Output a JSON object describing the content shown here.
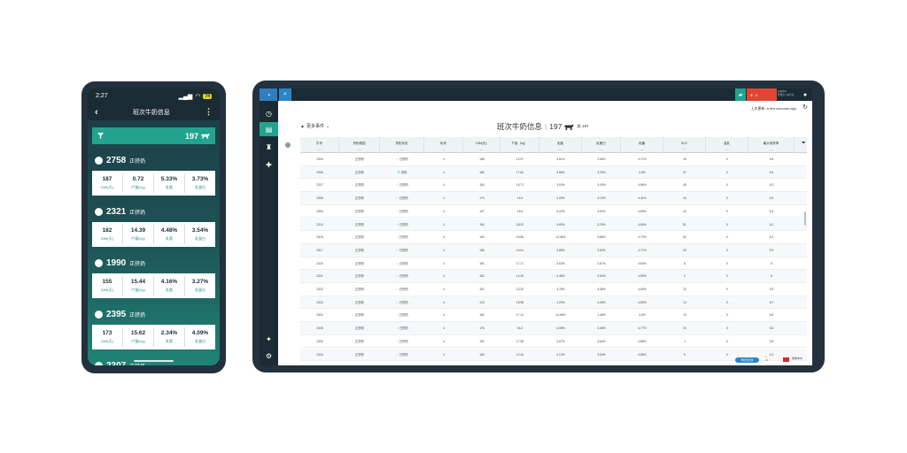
{
  "phone": {
    "time": "2:27",
    "battery": "74",
    "title": "班次牛奶信息",
    "count": "197",
    "items": [
      {
        "id": "2758",
        "type": "正挤奶",
        "dim": "187",
        "yield": "0.72",
        "fat": "5.33%",
        "protein": "3.73%",
        "dim_label": "DIM(天)",
        "yield_label": "产量(Kg)",
        "fat_label": "乳脂",
        "protein_label": "乳蛋白"
      },
      {
        "id": "2321",
        "type": "正挤奶",
        "dim": "182",
        "yield": "14.39",
        "fat": "4.48%",
        "protein": "3.54%",
        "dim_label": "DIM(天)",
        "yield_label": "产量(Kg)",
        "fat_label": "乳脂",
        "protein_label": "乳蛋白"
      },
      {
        "id": "1990",
        "type": "正挤奶",
        "dim": "155",
        "yield": "15.44",
        "fat": "4.16%",
        "protein": "3.27%",
        "dim_label": "DIM(天)",
        "yield_label": "产量(Kg)",
        "fat_label": "乳脂",
        "protein_label": "乳蛋白"
      },
      {
        "id": "2395",
        "type": "正挤奶",
        "dim": "173",
        "yield": "15.62",
        "fat": "2.34%",
        "protein": "4.09%",
        "dim_label": "DIM(天)",
        "yield_label": "产量(Kg)",
        "fat_label": "乳脂",
        "protein_label": "乳蛋白"
      },
      {
        "id": "2307",
        "type": "正挤奶"
      }
    ]
  },
  "tablet": {
    "alert_text": "4",
    "user_lines": [
      "gdfgfdsd",
      "管理员 1 用户名"
    ],
    "last_update": "上次更新: a few seconds ago",
    "more_events": "更多事件",
    "page_title": "班次牛奶信息",
    "count": "197",
    "count_total": "总 197",
    "columns": [
      "牛号",
      "挤奶原因",
      "挤奶状态",
      "乳号",
      "DIM(天)",
      "产量（kg）",
      "乳脂",
      "乳蛋白",
      "乳糖",
      "SCC",
      "温乳",
      "最大电导率"
    ],
    "filter_marks": [
      "—",
      "—",
      "—",
      "—",
      "—",
      "—",
      "—",
      "—",
      "—",
      "—",
      "—",
      "—"
    ],
    "rows": [
      [
        "2309",
        "正挤奶",
        "已挤奶",
        "4",
        "188",
        "12.97",
        "4.61%",
        "3.56%",
        "4.71%",
        "15",
        "0",
        "5.6"
      ],
      [
        "2306",
        "正挤奶",
        "挤奶",
        "4",
        "186",
        "17.64",
        "3.66%",
        "3.29%",
        "4.8%",
        "37",
        "0",
        "5.5"
      ],
      [
        "2307",
        "正挤奶",
        "已挤奶",
        "4",
        "184",
        "16.71",
        "3.64%",
        "3.43%",
        "4.86%",
        "48",
        "0",
        "6.3"
      ],
      [
        "2308",
        "正挤奶",
        "已挤奶",
        "4",
        "173",
        "13.3",
        "4.09%",
        "3.19%",
        "4.41%",
        "44",
        "0",
        "5.5"
      ],
      [
        "2300",
        "正挤奶",
        "已挤奶",
        "4",
        "147",
        "15.6",
        "5.22%",
        "3.52%",
        "4.89%",
        "44",
        "0",
        "5.4"
      ],
      [
        "2310",
        "正挤奶",
        "已挤奶",
        "4",
        "164",
        "18.02",
        "4.69%",
        "3.29%",
        "4.84%",
        "81",
        "0",
        "6.1"
      ],
      [
        "2315",
        "正挤奶",
        "已挤奶",
        "4",
        "160",
        "13.85",
        "13.36%",
        "0.86%",
        "4.72%",
        "50",
        "0",
        "6.2"
      ],
      [
        "2317",
        "正挤奶",
        "已挤奶",
        "4",
        "156",
        "13.01",
        "3.85%",
        "3.52%",
        "4.71%",
        "20",
        "0",
        "5.9"
      ],
      [
        "2320",
        "正挤奶",
        "已挤奶",
        "4",
        "191",
        "17.17",
        "4.63%",
        "3.67%",
        "4.84%",
        "8",
        "0",
        "6"
      ],
      [
        "2321",
        "正挤奶",
        "已挤奶",
        "4",
        "182",
        "14.29",
        "4.48%",
        "3.54%",
        "4.89%",
        "2",
        "0",
        "6"
      ],
      [
        "2322",
        "正挤奶",
        "已挤奶",
        "4",
        "152",
        "13.02",
        "4.78%",
        "3.48%",
        "4.65%",
        "12",
        "0",
        "5.5"
      ],
      [
        "2323",
        "正挤奶",
        "已挤奶",
        "4",
        "143",
        "15.96",
        "1.03%",
        "4.49%",
        "4.89%",
        "12",
        "0",
        "5.7"
      ],
      [
        "2324",
        "正挤奶",
        "已挤奶",
        "4",
        "180",
        "17.14",
        "13.66%",
        "1.46%",
        "4.6%",
        "10",
        "0",
        "6.6"
      ],
      [
        "2326",
        "正挤奶",
        "已挤奶",
        "4",
        "178",
        "16.2",
        "4.05%",
        "3.38%",
        "4.77%",
        "23",
        "0",
        "5.6"
      ],
      [
        "2330",
        "正挤奶",
        "已挤奶",
        "4",
        "152",
        "17.08",
        "3.67%",
        "3.64%",
        "4.85%",
        "1",
        "0",
        "5.5"
      ],
      [
        "2334",
        "正挤奶",
        "已挤奶",
        "4",
        "189",
        "12.44",
        "4.13%",
        "3.54%",
        "4.85%",
        "5",
        "0",
        "6.3"
      ]
    ],
    "footer_button": "导出到文件",
    "footer_page": [
      "1",
      "20"
    ],
    "footer_lang": "简体中文"
  }
}
